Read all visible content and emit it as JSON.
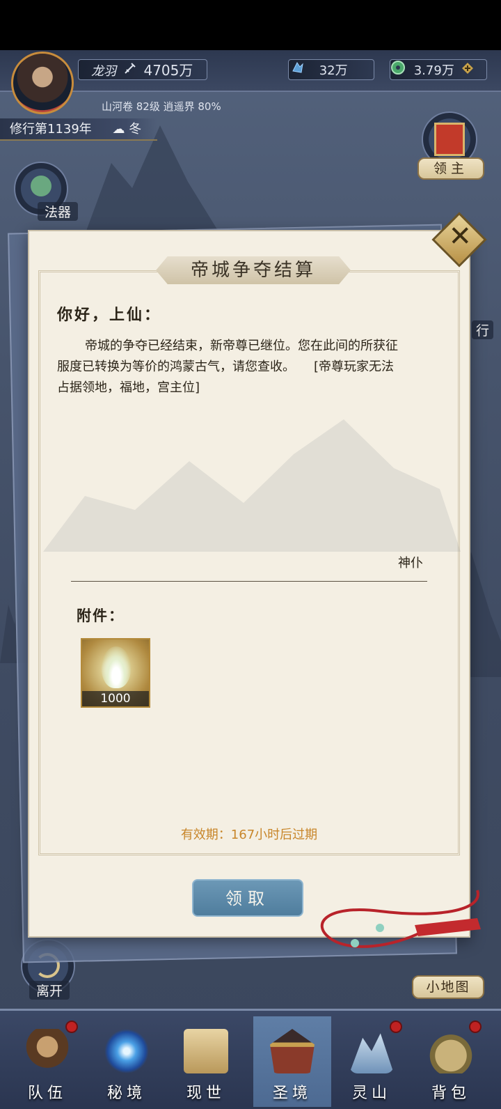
{
  "player": {
    "name": "龙羽",
    "power": "4705万",
    "currency1": "32万",
    "currency2": "3.79万",
    "realm_info": "山河卷 82级 逍遥界 80%",
    "year": "修行第1139年",
    "season": "冬"
  },
  "side_buttons": {
    "artifact": "法器",
    "lord": "领主",
    "leave": "离开",
    "minimap": "小地图",
    "partial_right": "行"
  },
  "mail": {
    "title": "帝城争夺结算",
    "greeting": "你好，上仙：",
    "body": "帝城的争夺已经结束，新帝尊已继位。您在此间的所获征服度已转换为等价的鸿蒙古气，请您查收。　　[帝尊玩家无法占据领地，福地，宫主位]",
    "sender": "神仆",
    "attachments_label": "附件：",
    "attachment_count": "1000",
    "expiry": "有效期：167小时后过期",
    "claim_button": "领取"
  },
  "bottom_nav": [
    {
      "label": "队伍",
      "dot": true,
      "active": false
    },
    {
      "label": "秘境",
      "dot": false,
      "active": false
    },
    {
      "label": "现世",
      "dot": false,
      "active": false
    },
    {
      "label": "圣境",
      "dot": false,
      "active": true
    },
    {
      "label": "灵山",
      "dot": true,
      "active": false
    },
    {
      "label": "背包",
      "dot": true,
      "active": false
    }
  ],
  "colors": {
    "accent_gold": "#c88c3c",
    "expiry_text": "#c8862a",
    "claim_button": "#5a88a8"
  }
}
